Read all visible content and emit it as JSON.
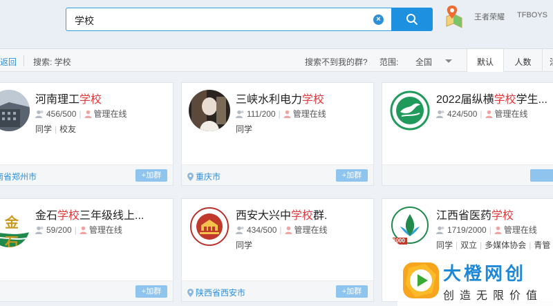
{
  "search": {
    "query": "学校",
    "clear_glyph": "×"
  },
  "nav": {
    "links": [
      "王者荣耀",
      "TFBOYS"
    ]
  },
  "filterbar": {
    "back_label": "返回",
    "search_label": "搜索: 学校",
    "not_found_label": "搜索不到我的群?",
    "range_label": "范围:",
    "range_value": "全国",
    "sort_tabs": [
      "默认",
      "人数",
      "活"
    ]
  },
  "labels": {
    "admin_online": "管理在线",
    "join": "+加群"
  },
  "groups": [
    {
      "name_pre": "河南理工",
      "name_hl": "学校",
      "name_post": "",
      "members": "456/500",
      "tags": [
        "同学",
        "校友"
      ],
      "location": "河南省郑州市"
    },
    {
      "name_pre": "三峡水利电力",
      "name_hl": "学校",
      "name_post": "",
      "members": "111/200",
      "tags": [
        "同学"
      ],
      "location": "重庆市"
    },
    {
      "name_pre": "2022届纵横",
      "name_hl": "学校",
      "name_post": "学生...",
      "members": "424/500",
      "tags": [],
      "location": ""
    },
    {
      "name_pre": "金石",
      "name_hl": "学校",
      "name_post": "三年级线上...",
      "members": "59/200",
      "tags": [],
      "location": ""
    },
    {
      "name_pre": "西安大兴中",
      "name_hl": "学校",
      "name_post": "群.",
      "members": "434/500",
      "tags": [
        "同学"
      ],
      "location": "陕西省西安市"
    },
    {
      "name_pre": "江西省医药",
      "name_hl": "学校",
      "name_post": "",
      "members": "1719/2000",
      "tags": [
        "同学",
        "双立",
        "多媒体协会",
        "青管"
      ],
      "location": ""
    }
  ],
  "avatar_texts": {
    "jinshi": "金石",
    "badge_2000": "2000"
  },
  "watermark": {
    "title": "大橙网创",
    "subtitle": "创造无限价值"
  },
  "colors": {
    "accent": "#1e90e0",
    "highlight": "#e4393c",
    "join_button": "#8fc4ef",
    "location": "#2e8fd9"
  }
}
